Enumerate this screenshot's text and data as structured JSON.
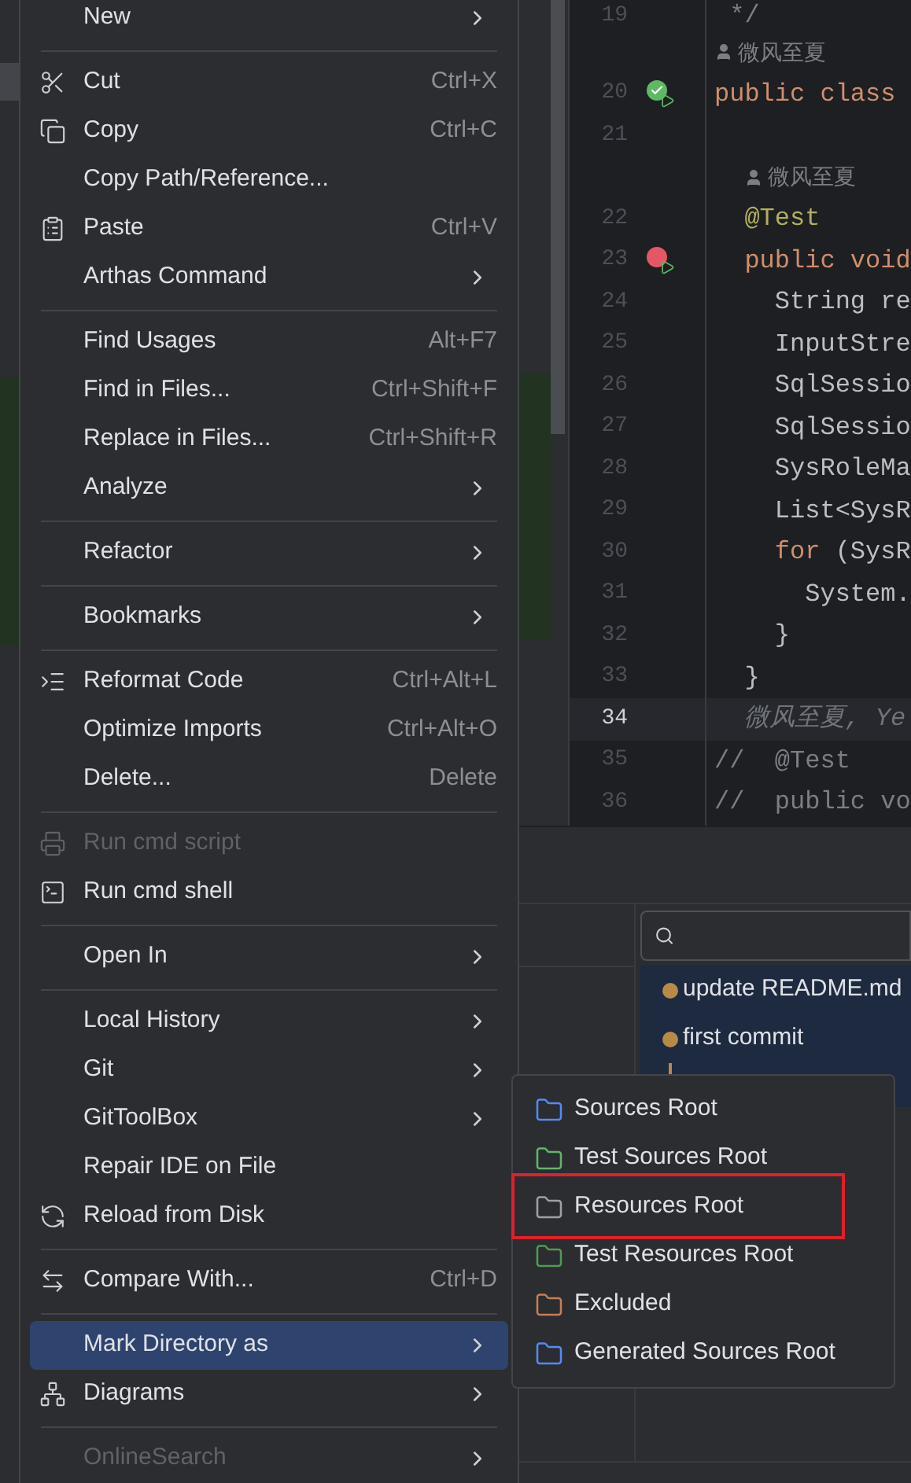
{
  "context_menu": {
    "groups": [
      [
        {
          "label": "New",
          "submenu": true,
          "disabled": false,
          "selected": false
        }
      ],
      [
        {
          "label": "Cut",
          "shortcut": "Ctrl+X",
          "submenu": false,
          "disabled": false,
          "selected": false
        },
        {
          "label": "Copy",
          "shortcut": "Ctrl+C",
          "submenu": false,
          "disabled": false,
          "selected": false
        },
        {
          "label": "Copy Path/Reference...",
          "submenu": false,
          "disabled": false,
          "selected": false
        },
        {
          "label": "Paste",
          "shortcut": "Ctrl+V",
          "submenu": false,
          "disabled": false,
          "selected": false
        },
        {
          "label": "Arthas Command",
          "submenu": true,
          "disabled": false,
          "selected": false
        }
      ],
      [
        {
          "label": "Find Usages",
          "shortcut": "Alt+F7",
          "submenu": false,
          "disabled": false,
          "selected": false
        },
        {
          "label": "Find in Files...",
          "shortcut": "Ctrl+Shift+F",
          "submenu": false,
          "disabled": false,
          "selected": false
        },
        {
          "label": "Replace in Files...",
          "shortcut": "Ctrl+Shift+R",
          "submenu": false,
          "disabled": false,
          "selected": false
        },
        {
          "label": "Analyze",
          "submenu": true,
          "disabled": false,
          "selected": false
        }
      ],
      [
        {
          "label": "Refactor",
          "submenu": true,
          "disabled": false,
          "selected": false
        }
      ],
      [
        {
          "label": "Bookmarks",
          "submenu": true,
          "disabled": false,
          "selected": false
        }
      ],
      [
        {
          "label": "Reformat Code",
          "shortcut": "Ctrl+Alt+L",
          "submenu": false,
          "disabled": false,
          "selected": false
        },
        {
          "label": "Optimize Imports",
          "shortcut": "Ctrl+Alt+O",
          "submenu": false,
          "disabled": false,
          "selected": false
        },
        {
          "label": "Delete...",
          "shortcut": "Delete",
          "submenu": false,
          "disabled": false,
          "selected": false
        }
      ],
      [
        {
          "label": "Run cmd script",
          "submenu": false,
          "disabled": true,
          "selected": false
        },
        {
          "label": "Run cmd shell",
          "submenu": false,
          "disabled": false,
          "selected": false
        }
      ],
      [
        {
          "label": "Open In",
          "submenu": true,
          "disabled": false,
          "selected": false
        }
      ],
      [
        {
          "label": "Local History",
          "submenu": true,
          "disabled": false,
          "selected": false
        },
        {
          "label": "Git",
          "submenu": true,
          "disabled": false,
          "selected": false
        },
        {
          "label": "GitToolBox",
          "submenu": true,
          "disabled": false,
          "selected": false
        },
        {
          "label": "Repair IDE on File",
          "submenu": false,
          "disabled": false,
          "selected": false
        },
        {
          "label": "Reload from Disk",
          "submenu": false,
          "disabled": false,
          "selected": false
        }
      ],
      [
        {
          "label": "Compare With...",
          "shortcut": "Ctrl+D",
          "submenu": false,
          "disabled": false,
          "selected": false
        }
      ],
      [
        {
          "label": "Mark Directory as",
          "submenu": true,
          "disabled": false,
          "selected": true
        },
        {
          "label": "Diagrams",
          "submenu": true,
          "disabled": false,
          "selected": false
        }
      ],
      [
        {
          "label": "OnlineSearch",
          "submenu": true,
          "disabled": true,
          "selected": false
        }
      ]
    ]
  },
  "submenu": {
    "items": [
      {
        "label": "Sources Root",
        "color": "#548af7",
        "highlighted": false
      },
      {
        "label": "Test Sources Root",
        "color": "#5fb865",
        "highlighted": false
      },
      {
        "label": "Resources Root",
        "color": "#9da0a8",
        "highlighted": true
      },
      {
        "label": "Test Resources Root",
        "color": "#4f9a56",
        "highlighted": false
      },
      {
        "label": "Excluded",
        "color": "#c77d55",
        "highlighted": false
      },
      {
        "label": "Generated Sources Root",
        "color": "#548af7",
        "highlighted": false
      }
    ]
  },
  "editor": {
    "lines": [
      {
        "kind": "code",
        "number": "19",
        "current": false,
        "tokens": [
          {
            "text": " */",
            "kind": "comment"
          }
        ]
      },
      {
        "kind": "author",
        "text": "微风至夏"
      },
      {
        "kind": "code",
        "number": "20",
        "gutter": {
          "kind": "passed"
        },
        "current": false,
        "tokens": [
          {
            "text": "public class",
            "kind": "keyword"
          }
        ]
      },
      {
        "kind": "code",
        "number": "21",
        "current": false
      },
      {
        "kind": "author",
        "text": "微风至夏"
      },
      {
        "kind": "code",
        "number": "22",
        "current": false,
        "tokens": [
          {
            "text": "  @Test",
            "kind": "annotation"
          }
        ]
      },
      {
        "kind": "code",
        "number": "23",
        "gutter": {
          "kind": "failed"
        },
        "current": false,
        "tokens": [
          {
            "text": "  public void",
            "kind": "keyword"
          }
        ]
      },
      {
        "kind": "code",
        "number": "24",
        "current": false,
        "tokens": [
          {
            "text": "    String re",
            "kind": "plain"
          }
        ]
      },
      {
        "kind": "code",
        "number": "25",
        "current": false,
        "tokens": [
          {
            "text": "    InputStre",
            "kind": "plain"
          }
        ]
      },
      {
        "kind": "code",
        "number": "26",
        "current": false,
        "tokens": [
          {
            "text": "    SqlSessio",
            "kind": "plain"
          }
        ]
      },
      {
        "kind": "code",
        "number": "27",
        "current": false,
        "tokens": [
          {
            "text": "    SqlSessio",
            "kind": "plain"
          }
        ]
      },
      {
        "kind": "code",
        "number": "28",
        "current": false,
        "tokens": [
          {
            "text": "    SysRoleMa",
            "kind": "plain"
          }
        ]
      },
      {
        "kind": "code",
        "number": "29",
        "current": false,
        "tokens": [
          {
            "text": "    List<SysR",
            "kind": "plain"
          }
        ]
      },
      {
        "kind": "code",
        "number": "30",
        "current": false,
        "tokens": [
          {
            "text": "    for",
            "kind": "keyword"
          },
          {
            "text": " (SysR",
            "kind": "plain"
          }
        ]
      },
      {
        "kind": "code",
        "number": "31",
        "current": false,
        "tokens": [
          {
            "text": "      System.",
            "kind": "plain"
          }
        ]
      },
      {
        "kind": "code",
        "number": "32",
        "current": false,
        "tokens": [
          {
            "text": "    }",
            "kind": "plain"
          }
        ]
      },
      {
        "kind": "code",
        "number": "33",
        "current": false,
        "tokens": [
          {
            "text": "  }",
            "kind": "plain"
          }
        ]
      },
      {
        "kind": "code",
        "number": "34",
        "current": true,
        "tokens": [
          {
            "text": "  微风至夏, Ye",
            "kind": "hint"
          }
        ]
      },
      {
        "kind": "code",
        "number": "35",
        "current": false,
        "tokens": [
          {
            "text": "//  @Test",
            "kind": "comment"
          }
        ]
      },
      {
        "kind": "code",
        "number": "36",
        "current": false,
        "tokens": [
          {
            "text": "//  public vo",
            "kind": "comment"
          }
        ]
      }
    ]
  },
  "git_log": {
    "commits": [
      {
        "message": "update README.md",
        "selected": true
      },
      {
        "message": "first commit",
        "selected": true
      }
    ]
  }
}
